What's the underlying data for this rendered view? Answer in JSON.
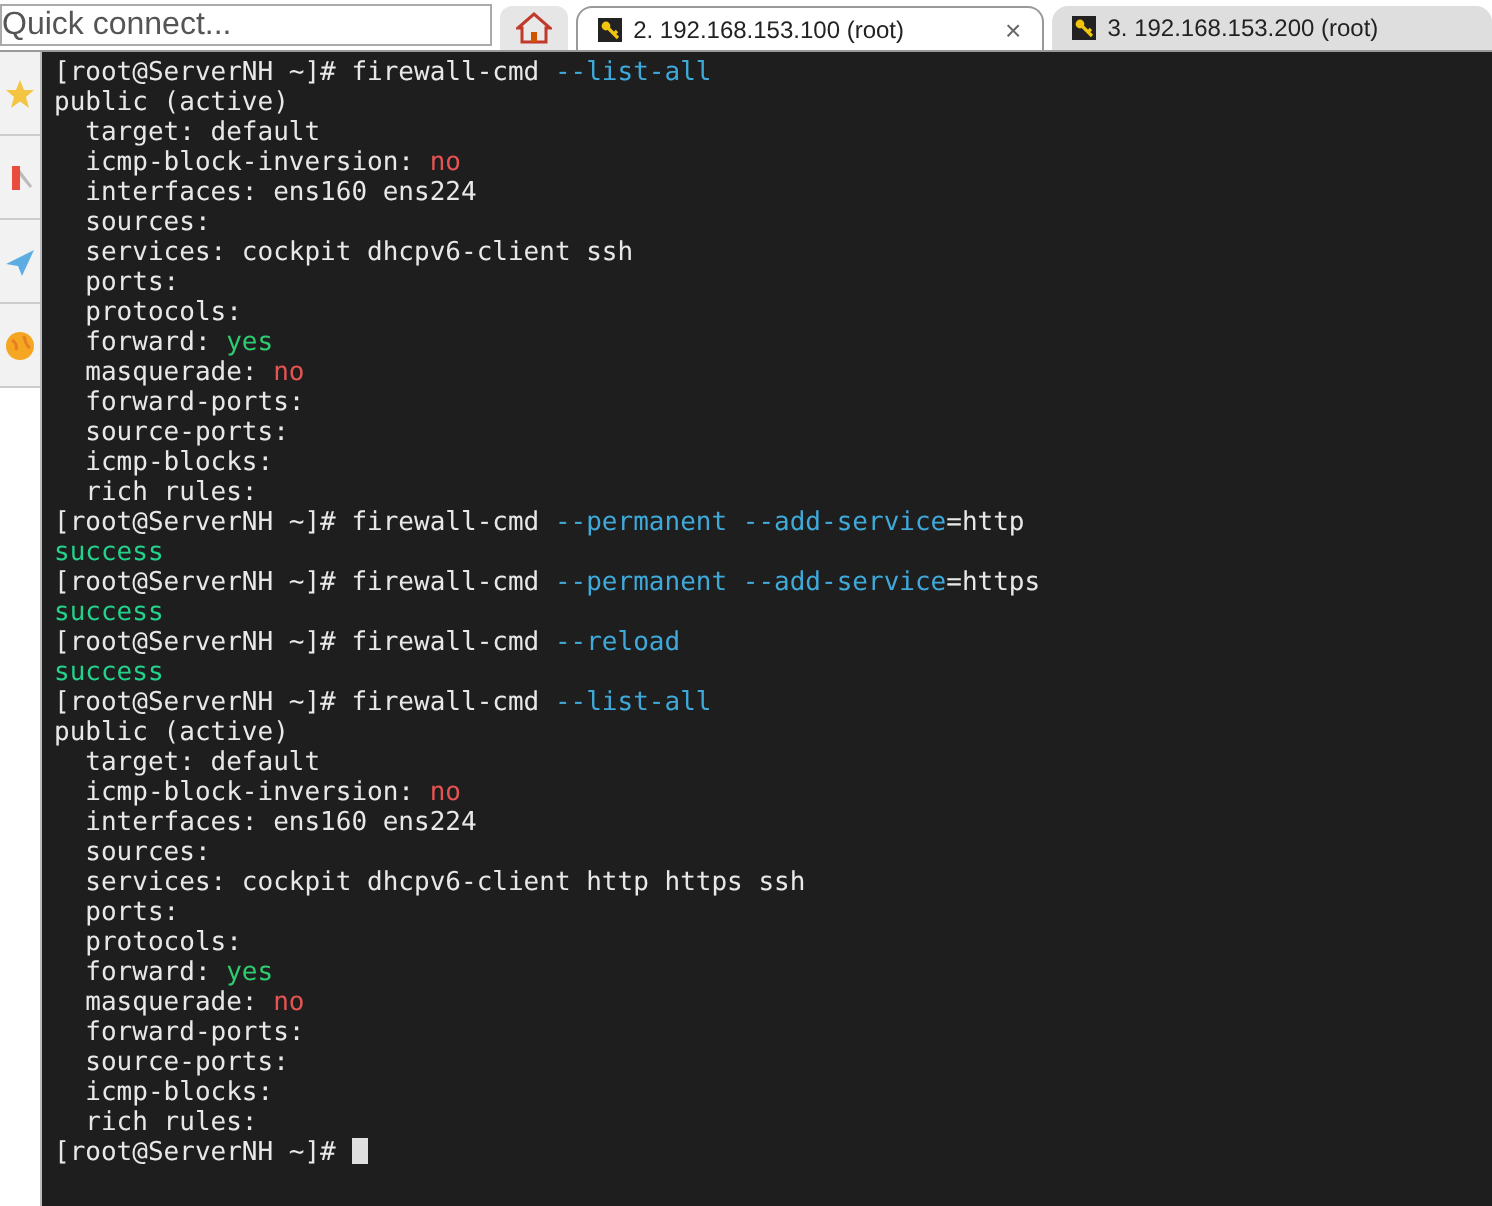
{
  "quick_connect": {
    "placeholder": "Quick connect..."
  },
  "tabs": [
    {
      "label": "2. 192.168.153.100 (root)",
      "selected": true,
      "close": "×"
    },
    {
      "label": "3. 192.168.153.200 (root)",
      "selected": false
    }
  ],
  "terminal": {
    "cursor": true,
    "lines": [
      [
        {
          "text": "[root@ServerNH ~]# firewall-cmd ",
          "kind": "plain"
        },
        {
          "text": "--list-all",
          "kind": "option"
        }
      ],
      [
        {
          "text": "public (active)",
          "kind": "plain"
        }
      ],
      [
        {
          "text": "  target: default",
          "kind": "plain"
        }
      ],
      [
        {
          "text": "  icmp-block-inversion: ",
          "kind": "plain"
        },
        {
          "text": "no",
          "kind": "no"
        }
      ],
      [
        {
          "text": "  interfaces: ens160 ens224",
          "kind": "plain"
        }
      ],
      [
        {
          "text": "  sources:",
          "kind": "plain"
        }
      ],
      [
        {
          "text": "  services: cockpit dhcpv6-client ssh",
          "kind": "plain"
        }
      ],
      [
        {
          "text": "  ports:",
          "kind": "plain"
        }
      ],
      [
        {
          "text": "  protocols:",
          "kind": "plain"
        }
      ],
      [
        {
          "text": "  forward: ",
          "kind": "plain"
        },
        {
          "text": "yes",
          "kind": "yes"
        }
      ],
      [
        {
          "text": "  masquerade: ",
          "kind": "plain"
        },
        {
          "text": "no",
          "kind": "no"
        }
      ],
      [
        {
          "text": "  forward-ports:",
          "kind": "plain"
        }
      ],
      [
        {
          "text": "  source-ports:",
          "kind": "plain"
        }
      ],
      [
        {
          "text": "  icmp-blocks:",
          "kind": "plain"
        }
      ],
      [
        {
          "text": "  rich rules:",
          "kind": "plain"
        }
      ],
      [
        {
          "text": "[root@ServerNH ~]# firewall-cmd ",
          "kind": "plain"
        },
        {
          "text": "--permanent --add-service",
          "kind": "option"
        },
        {
          "text": "=http",
          "kind": "plain"
        }
      ],
      [
        {
          "text": "success",
          "kind": "success"
        }
      ],
      [
        {
          "text": "[root@ServerNH ~]# firewall-cmd ",
          "kind": "plain"
        },
        {
          "text": "--permanent --add-service",
          "kind": "option"
        },
        {
          "text": "=https",
          "kind": "plain"
        }
      ],
      [
        {
          "text": "success",
          "kind": "success"
        }
      ],
      [
        {
          "text": "[root@ServerNH ~]# firewall-cmd ",
          "kind": "plain"
        },
        {
          "text": "--reload",
          "kind": "option"
        }
      ],
      [
        {
          "text": "success",
          "kind": "success"
        }
      ],
      [
        {
          "text": "[root@ServerNH ~]# firewall-cmd ",
          "kind": "plain"
        },
        {
          "text": "--list-all",
          "kind": "option"
        }
      ],
      [
        {
          "text": "public (active)",
          "kind": "plain"
        }
      ],
      [
        {
          "text": "  target: default",
          "kind": "plain"
        }
      ],
      [
        {
          "text": "  icmp-block-inversion: ",
          "kind": "plain"
        },
        {
          "text": "no",
          "kind": "no"
        }
      ],
      [
        {
          "text": "  interfaces: ens160 ens224",
          "kind": "plain"
        }
      ],
      [
        {
          "text": "  sources:",
          "kind": "plain"
        }
      ],
      [
        {
          "text": "  services: cockpit dhcpv6-client http https ssh",
          "kind": "plain"
        }
      ],
      [
        {
          "text": "  ports:",
          "kind": "plain"
        }
      ],
      [
        {
          "text": "  protocols:",
          "kind": "plain"
        }
      ],
      [
        {
          "text": "  forward: ",
          "kind": "plain"
        },
        {
          "text": "yes",
          "kind": "yes"
        }
      ],
      [
        {
          "text": "  masquerade: ",
          "kind": "plain"
        },
        {
          "text": "no",
          "kind": "no"
        }
      ],
      [
        {
          "text": "  forward-ports:",
          "kind": "plain"
        }
      ],
      [
        {
          "text": "  source-ports:",
          "kind": "plain"
        }
      ],
      [
        {
          "text": "  icmp-blocks:",
          "kind": "plain"
        }
      ],
      [
        {
          "text": "  rich rules:",
          "kind": "plain"
        }
      ],
      [
        {
          "text": "[root@ServerNH ~]# ",
          "kind": "plain"
        }
      ]
    ]
  }
}
